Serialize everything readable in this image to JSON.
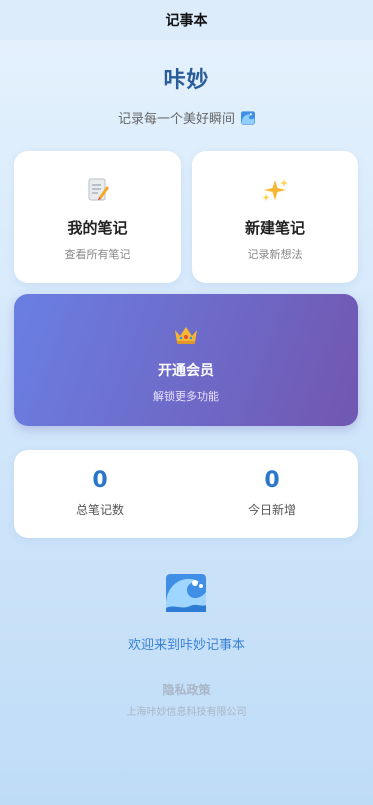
{
  "navbar": {
    "title": "记事本"
  },
  "hero": {
    "app_name": "咔妙",
    "subtitle": "记录每一个美好瞬间",
    "subtitle_icon": "wave-icon"
  },
  "cards": [
    {
      "icon": "memo-icon",
      "title": "我的笔记",
      "subtitle": "查看所有笔记"
    },
    {
      "icon": "sparkles-icon",
      "title": "新建笔记",
      "subtitle": "记录新想法"
    }
  ],
  "vip": {
    "icon": "crown-icon",
    "title": "开通会员",
    "subtitle": "解锁更多功能",
    "gradient_start": "#6a7fe3",
    "gradient_end": "#7157b0"
  },
  "stats": [
    {
      "value": "0",
      "label": "总笔记数"
    },
    {
      "value": "0",
      "label": "今日新增"
    }
  ],
  "footer": {
    "icon": "wave-icon",
    "welcome": "欢迎来到咔妙记事本",
    "privacy": "隐私政策",
    "company": "上海咔妙信息科技有限公司"
  },
  "colors": {
    "accent": "#2a77c9",
    "brand": "#2a5c9a"
  }
}
